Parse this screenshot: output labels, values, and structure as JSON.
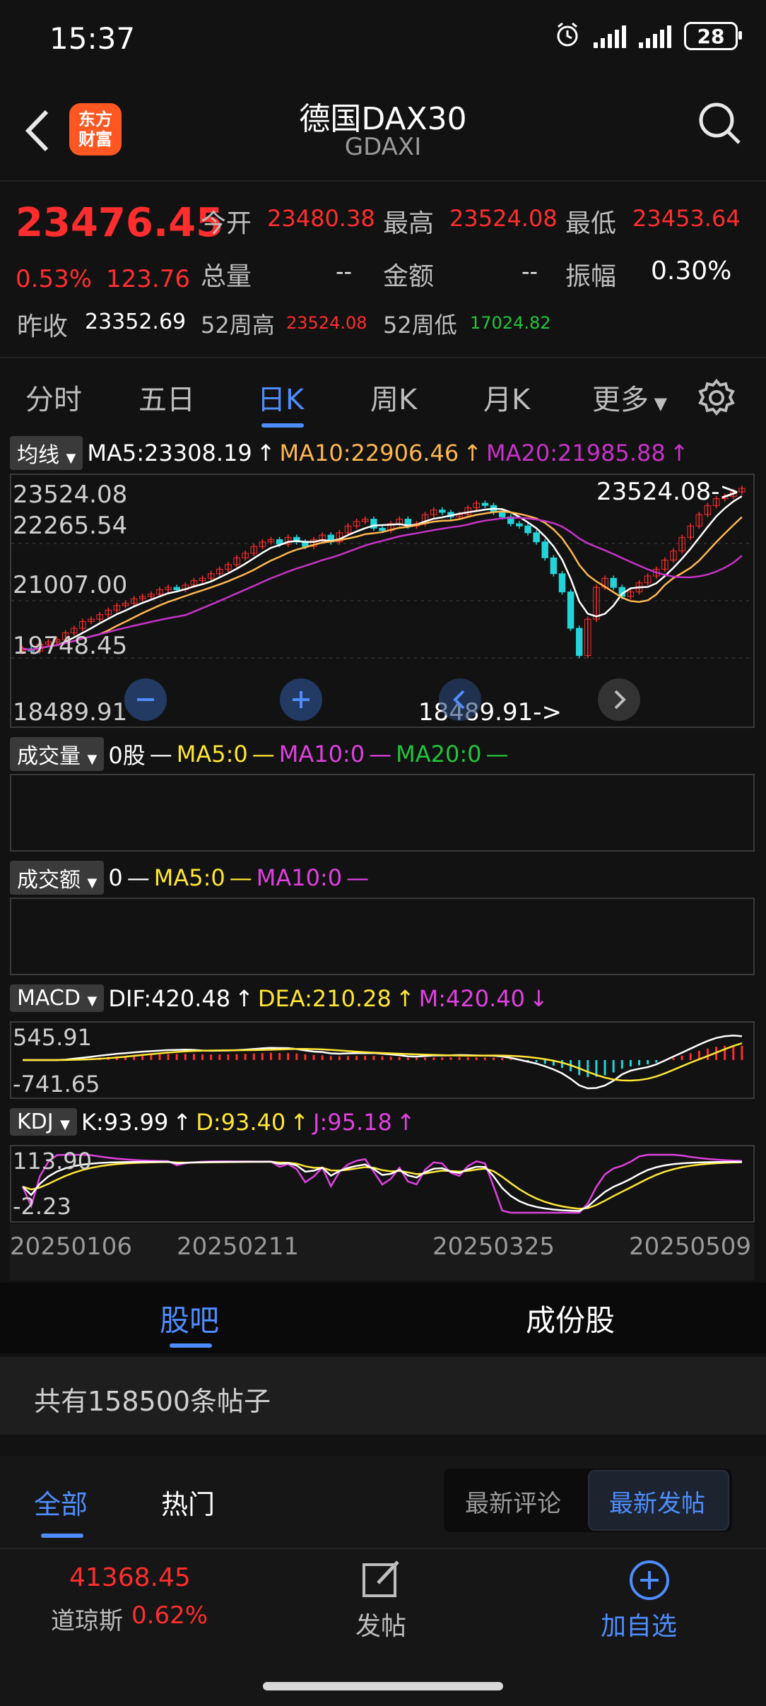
{
  "status_bar": {
    "time": "15:37",
    "battery": "28"
  },
  "header": {
    "title": "德国DAX30",
    "subtitle": "GDAXI",
    "logo_line1": "东方",
    "logo_line2": "财富"
  },
  "quote": {
    "last_price": "23476.45",
    "change_pct": "0.53%",
    "change_abs": "123.76",
    "open_label": "今开",
    "open": "23480.38",
    "high_label": "最高",
    "high": "23524.08",
    "low_label": "最低",
    "low": "23453.64",
    "volume_label": "总量",
    "volume": "--",
    "amount_label": "金额",
    "amount": "--",
    "amplitude_label": "振幅",
    "amplitude": "0.30%",
    "prev_close_label": "昨收",
    "prev_close": "23352.69",
    "week52_high_label": "52周高",
    "week52_high": "23524.08",
    "week52_low_label": "52周低",
    "week52_low": "17024.82"
  },
  "period_tabs": [
    "分时",
    "五日",
    "日K",
    "周K",
    "月K",
    "更多"
  ],
  "active_period": "日K",
  "ma_legend": {
    "tag": "均线",
    "ma5": "MA5:23308.19",
    "ma10": "MA10:22906.46",
    "ma20": "MA20:21985.88",
    "arrow": "↑"
  },
  "price_axis": [
    "23524.08",
    "22265.54",
    "21007.00",
    "19748.45",
    "18489.91"
  ],
  "price_annotations": {
    "high_note": "23524.08->",
    "low_note": "18489.91->"
  },
  "volume_legend": {
    "tag": "成交量",
    "v0": "0股",
    "ma5": "MA5:0",
    "ma10": "MA10:0",
    "ma20": "MA20:0",
    "dash": "—"
  },
  "amount_legend": {
    "tag": "成交额",
    "v0": "0",
    "ma5": "MA5:0",
    "ma10": "MA10:0",
    "dash": "—"
  },
  "macd_legend": {
    "tag": "MACD",
    "dif": "DIF:420.48",
    "dea": "DEA:210.28",
    "m": "M:420.40",
    "up": "↑",
    "down": "↓"
  },
  "macd_axis": [
    "545.91",
    "-741.65"
  ],
  "kdj_legend": {
    "tag": "KDJ",
    "k": "K:93.99",
    "d": "D:93.40",
    "j": "J:95.18",
    "up": "↑"
  },
  "kdj_axis": [
    "113.90",
    "-2.23"
  ],
  "date_axis": [
    "20250106",
    "20250211",
    "20250325",
    "20250509"
  ],
  "section_tabs": [
    "股吧",
    "成份股"
  ],
  "post_count": "共有158500条帖子",
  "filter_tabs": [
    "全部",
    "热门"
  ],
  "sort_buttons": [
    "最新评论",
    "最新发帖"
  ],
  "bottom": {
    "dow_value": "41368.45",
    "dow_name": "道琼斯",
    "dow_pct": "0.62%",
    "post_label": "发帖",
    "watch_label": "加自选"
  },
  "colors": {
    "up": "#ff2d2d",
    "down": "#22d3d8",
    "accent": "#4e8dff",
    "ma5": "#ffffff",
    "ma10": "#ffb74d",
    "ma20": "#c832c8"
  },
  "chart_data": {
    "type": "candlestick",
    "ylim": [
      18489.91,
      23524.08
    ],
    "close": [
      19950,
      19900,
      20050,
      20100,
      20150,
      20300,
      20400,
      20550,
      20600,
      20700,
      20800,
      20900,
      20950,
      21050,
      21100,
      21150,
      21250,
      21300,
      21250,
      21350,
      21450,
      21500,
      21600,
      21700,
      21800,
      21950,
      22050,
      22200,
      22300,
      22350,
      22250,
      22400,
      22300,
      22200,
      22350,
      22450,
      22300,
      22500,
      22650,
      22750,
      22800,
      22600,
      22550,
      22700,
      22800,
      22650,
      22700,
      22900,
      23000,
      22950,
      22850,
      22900,
      23050,
      23150,
      23100,
      22950,
      22850,
      22700,
      22650,
      22500,
      22300,
      21950,
      21600,
      21200,
      20400,
      19800,
      20600,
      21300,
      21500,
      21300,
      21100,
      21200,
      21400,
      21550,
      21700,
      21900,
      22100,
      22400,
      22650,
      22900,
      23100,
      23250,
      23300,
      23400,
      23476
    ],
    "ma_last": {
      "ma5": 23308.19,
      "ma10": 22906.46,
      "ma20": 21985.88
    }
  }
}
